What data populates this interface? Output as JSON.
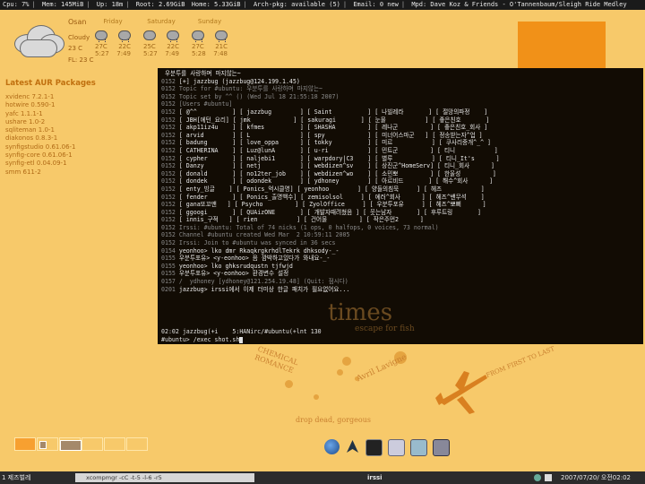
{
  "status_bar": {
    "cpu": "Cpu: 7%",
    "mem": "Mem: 145MiB",
    "up": "Up: 18m",
    "root": "Root: 2.69GiB",
    "home": "Home: 5.33GiB",
    "arch": "Arch-pkg: available (5)",
    "email": "Email: 0 new",
    "mpd": "Mpd:  Dave Koz & Friends - O'Tannenbaum/Sleigh Ride Medley"
  },
  "weather": {
    "location": "Osan",
    "condition": "Cloudy",
    "current_temp": "23 C",
    "feels_like": "FL: 23 C",
    "days": [
      {
        "name": "Friday",
        "temp_a": "27C",
        "temp_b": "22C",
        "time_a": "5:27",
        "time_b": "7:49"
      },
      {
        "name": "Saturday",
        "temp_a": "25C",
        "temp_b": "22C",
        "time_a": "5:27",
        "time_b": "7:49"
      },
      {
        "name": "Sunday",
        "temp_a": "27C",
        "temp_b": "21C",
        "time_a": "5:28",
        "time_b": "7:48"
      }
    ]
  },
  "aur": {
    "title": "Latest AUR Packages",
    "packages": [
      "xvidenc 7.2.1-1",
      "hotwire 0.590-1",
      "yafc 1.1.1-1",
      "ushare 1.0-2",
      "sqliteman 1.0-1",
      "diakonos 0.8.3-1",
      "synfigstudio 0.61.06-1",
      "synfig-core 0.61.06-1",
      "synfig-etl 0.04.09-1",
      "smm 611-2"
    ]
  },
  "terminal": {
    "lines": [
      {
        "ts": "",
        "text": " 우분투를 사랑하며 마지않는~",
        "dim": false
      },
      {
        "ts": "0152",
        "text": " [+] jazzbug (jazzbug@124.199.1.45)",
        "dim": false
      },
      {
        "ts": "0152",
        "text": " Topic for #ubuntu: 우분투를 사랑하며 마지않는~",
        "dim": true
      },
      {
        "ts": "0152",
        "text": " Topic set by ^^ () (Wed Jul 18 21:55:18 2007)",
        "dim": true
      },
      {
        "ts": "0152",
        "text": " [Users #ubuntu]",
        "dim": true
      },
      {
        "ts": "0152",
        "text": " [ @^^          ] [ jazzbug        ] [ Saint          ] [ 나빌레라       ] [ 절망의파정    ]",
        "dim": false
      },
      {
        "ts": "0152",
        "text": " [ JBH[에턴_요리] [ jmk            ] [ sakuragi       ] [ 눈물           ] [ 좋은친호       ]",
        "dim": false
      },
      {
        "ts": "0152",
        "text": " [ akp11iz4u    ] [ kfmes          ] [ SHASHA         ] [ 레나군         ] [ 좋은친호_회사 ]",
        "dim": false
      },
      {
        "ts": "0152",
        "text": " [ arvid        ] [ L              ] [ spy            ] [ 미너어스마군   ] [ 정송받는자^업 ]",
        "dim": false
      },
      {
        "ts": "0152",
        "text": " [ badung       ] [ love_oppa      ] [ tokky          ] [ 미르           ] [ 쿠사리중개^_^ ]",
        "dim": false
      },
      {
        "ts": "0152",
        "text": " [ CATHERINA    ] [ Luz@lunA       ] [ u-ri           ] [ 민트군         ] [ 티니           ]",
        "dim": false
      },
      {
        "ts": "0152",
        "text": " [ cypher       ] [ naljebi1       ] [ warpdory|C3    ] [ 별루           ] [ 티니_It's      ]",
        "dim": false
      },
      {
        "ts": "0152",
        "text": " [ Danzy        ] [ netj           ] [ webdizen^sv    ] [ 상진군^HomeServ] [ 티니_회사      ]",
        "dim": false
      },
      {
        "ts": "0152",
        "text": " [ donald       ] [ no12ter_job    ] [ webdizen^wo    ] [ 소민뽀         ] [ 한울성         ]",
        "dim": false
      },
      {
        "ts": "0152",
        "text": " [ dondek       ] [ odondek        ] [ ydhoney        ] [ 아르비드       ] [ 해수^회사      ]",
        "dim": false
      },
      {
        "ts": "0152",
        "text": " [ enty_빙글    ] [ Ponics_억시클명] [ yeonhoo        ] [ 양들의침묵     ] [ 헤즈           ]",
        "dim": false
      },
      {
        "ts": "0152",
        "text": " [ fender       ] [ Ponics_출명백수] [ zemisolsol     ] [ 에러^회사      ] [ 헤즈^밴무석    ]",
        "dim": false
      },
      {
        "ts": "0152",
        "text": " [ gana또꼬맨   ] [ Psycho         ] [ ZyolOffice     ] [ 우분투포유     ] [ 헤즈^뽀뻐      ]",
        "dim": false
      },
      {
        "ts": "0152",
        "text": " [ ggoogi       ] [ QUAizONE       ] [ 개발자때려쳤음 ] [ 웃는남자       ] [ 후루트링       ]",
        "dim": false
      },
      {
        "ts": "0152",
        "text": " [ innis_구적   ] [ rien           ] [ 건어물         ] [ 작은주먼2      ]",
        "dim": false
      },
      {
        "ts": "0152",
        "text": " Irssi: #ubuntu: Total of 74 nicks (1 ops, 0 halfops, 0 voices, 73 normal)",
        "dim": true
      },
      {
        "ts": "0152",
        "text": " Channel #ubuntu created Wed Mar  2 10:59:11 2005",
        "dim": true
      },
      {
        "ts": "0152",
        "text": " Irssi: Join to #ubuntu was synced in 36 secs",
        "dim": true
      },
      {
        "ts": "0154",
        "text": " yeonhoo> lko dmr RkaqkrgkrhdlTekrk dhksody-_-",
        "dim": false
      },
      {
        "ts": "0155",
        "text": " 우분투포유> <y-eonhoo> 음 깜박하고있다가 와내요-_-",
        "dim": false
      },
      {
        "ts": "0155",
        "text": " yeonhoo> lko ghksrudqustn tjfwjd",
        "dim": false
      },
      {
        "ts": "0155",
        "text": " 우분투포유> <y-eonhoo> 환경변수 설정",
        "dim": false
      },
      {
        "ts": "0157",
        "text": " /  ydhoney [ydhoney@121.254.19.48] (Quit: 점시다)",
        "dim": true
      },
      {
        "ts": "0201",
        "text": " jazzbug> irssi에서 이제 터미상 한글 패치가 필요없어요...",
        "dim": false
      }
    ],
    "status_line": "02:02 jazzbug(+i    5:HANirc/#ubuntu(+lnt 130",
    "input_prompt": "#ubuntu> /exec shot.sh",
    "watermark_a": "times",
    "watermark_b": "escape for fish"
  },
  "wallpaper": {
    "text_a": "Avril Lavigne",
    "text_b": "FROM FIRST TO LAST",
    "text_c": "drop dead, gorgeous",
    "text_d": "CHEMICAL ROMANCE"
  },
  "taskbar": {
    "workspace": "1 제즈벌레",
    "run_task": "xcompmgr -cC -t-5 -l-6 -r5",
    "irssi_task": "irssi",
    "clock": "2007/07/20/ 오전02:02"
  }
}
